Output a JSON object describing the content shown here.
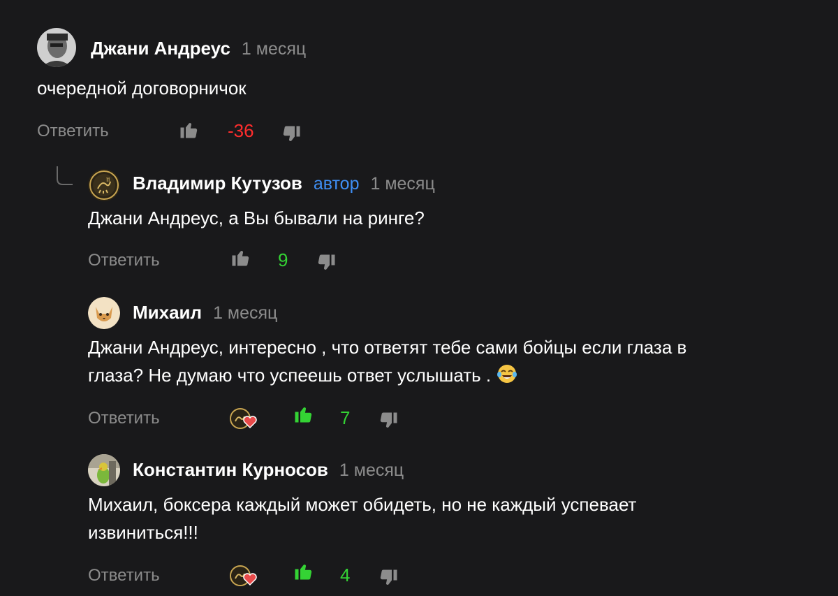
{
  "comments": [
    {
      "author": "Джани Андреус",
      "time": "1 месяц",
      "text": "очередной договорничок",
      "reply_label": "Ответить",
      "score": "-36",
      "score_color": "#ff2d2d"
    },
    {
      "author": "Владимир Кутузов",
      "role": "автор",
      "time": "1 месяц",
      "text": "Джани Андреус, а Вы бывали на ринге?",
      "reply_label": "Ответить",
      "score": "9",
      "score_color": "#34d334"
    },
    {
      "author": "Михаил",
      "time": "1 месяц",
      "text_line1": "Джани Андреус, интересно , что ответят тебе сами бойцы если глаза в",
      "text_line2": "глаза? Не думаю что успеешь ответ услышать .",
      "emoji": "tears-of-joy-emoji",
      "reply_label": "Ответить",
      "score": "7",
      "score_color": "#34d334",
      "liked": true,
      "author_liked": true
    },
    {
      "author": "Константин Курносов",
      "time": "1 месяц",
      "text_line1": "Михаил, боксера каждый может обидеть, но не каждый успевает",
      "text_line2": "извиниться!!!",
      "reply_label": "Ответить",
      "score": "4",
      "score_color": "#34d334",
      "liked": true,
      "author_liked": true
    }
  ],
  "colors": {
    "background": "#19191b",
    "author_badge": "#3f8ff5",
    "muted": "#8c8c8c",
    "positive": "#34d334",
    "negative": "#ff2d2d"
  }
}
